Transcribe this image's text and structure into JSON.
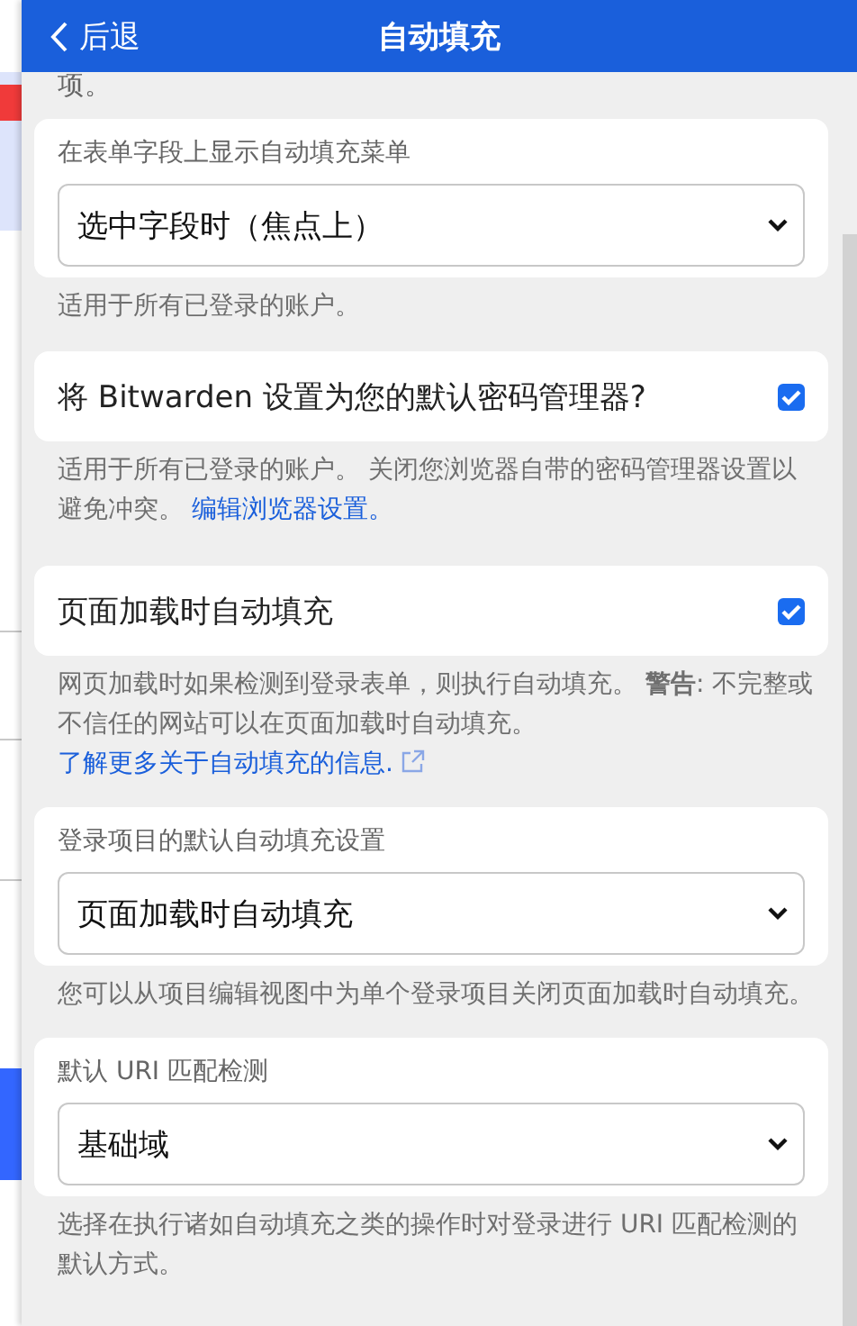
{
  "header": {
    "back_label": "后退",
    "title": "自动填充"
  },
  "top_fragment": "项。",
  "settings": [
    {
      "kind": "select",
      "label": "在表单字段上显示自动填充菜单",
      "value": "选中字段时（焦点上）",
      "help": "适用于所有已登录的账户。"
    },
    {
      "kind": "checkbox",
      "label": "将 Bitwarden 设置为您的默认密码管理器?",
      "checked": true,
      "help": "适用于所有已登录的账户。 关闭您浏览器自带的密码管理器设置以避免冲突。 ",
      "help_link": "编辑浏览器设置。",
      "link_external": false
    },
    {
      "kind": "checkbox",
      "label": "页面加载时自动填充",
      "checked": true,
      "help": "网页加载时如果检测到登录表单，则执行自动填充。 **警告**: 不完整或不信任的网站可以在页面加载时自动填充。 ",
      "help_link": "了解更多关于自动填充的信息.",
      "link_external": true
    },
    {
      "kind": "select",
      "label": "登录项目的默认自动填充设置",
      "value": "页面加载时自动填充",
      "help": "您可以从项目编辑视图中为单个登录项目关闭页面加载时自动填充。"
    },
    {
      "kind": "select",
      "label": "默认 URI 匹配检测",
      "value": "基础域",
      "help": "选择在执行诸如自动填充之类的操作时对登录进行 URI 匹配检测的默认方式。"
    }
  ]
}
